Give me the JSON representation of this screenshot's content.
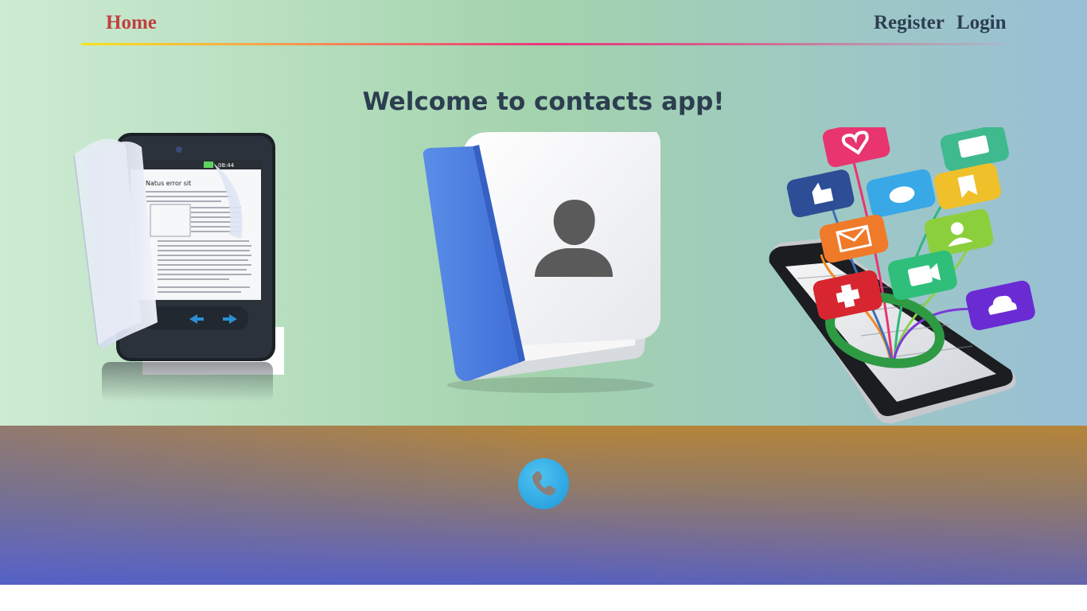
{
  "nav": {
    "home_label": "Home",
    "register_label": "Register",
    "login_label": "Login",
    "home_color": "#c0403e",
    "link_color": "#2c3e50"
  },
  "hero": {
    "title": "Welcome to contacts app!",
    "title_color": "#2c3e50",
    "ebook_text_heading": "Natus error sit",
    "ebook_status_time": "08:44"
  },
  "icons": {
    "left": "ebook-phone-icon",
    "center": "contacts-book-icon",
    "right": "social-share-phone-icon",
    "footer": "phone-call-icon"
  },
  "colors": {
    "footer_accent": "#1d97d8",
    "book_cover": "#4a7fe0"
  }
}
